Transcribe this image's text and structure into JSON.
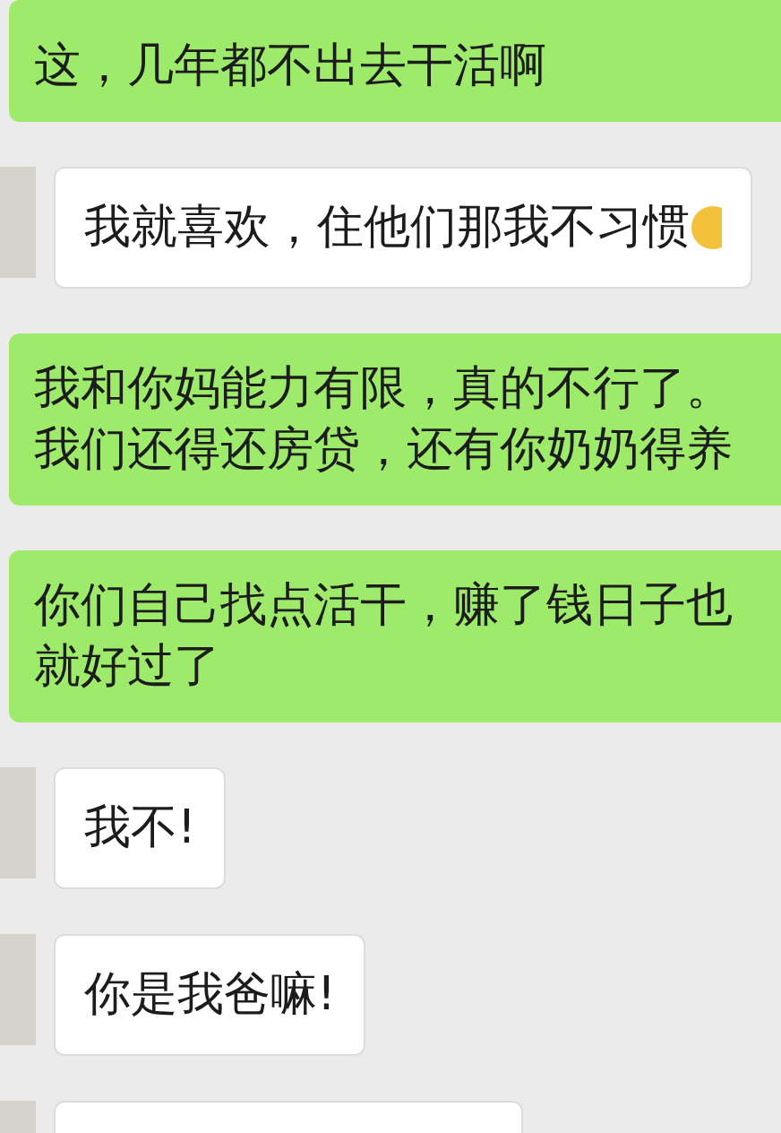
{
  "messages": [
    {
      "kind": "sent",
      "lines": [
        "这，几年都不出去干活啊"
      ]
    },
    {
      "kind": "received",
      "lines": [
        "我就喜欢，住他们那我不习惯"
      ],
      "emoji": true
    },
    {
      "kind": "sent",
      "lines": [
        "我和你妈能力有限，真的不行了。",
        "我们还得还房贷，还有你奶奶得养"
      ]
    },
    {
      "kind": "sent",
      "lines": [
        "你们自己找点活干，赚了钱日子也",
        "就好过了"
      ]
    },
    {
      "kind": "received",
      "lines": [
        "我不!"
      ]
    },
    {
      "kind": "received",
      "lines": [
        "你是我爸嘛!"
      ]
    },
    {
      "kind": "received"
    }
  ]
}
